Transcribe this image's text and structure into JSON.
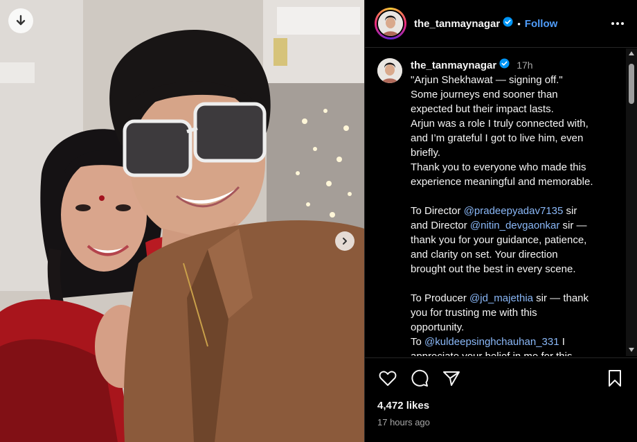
{
  "post": {
    "username": "the_tanmaynagar",
    "follow_label": "Follow",
    "separator": "•",
    "time_short": "17h",
    "likes": "4,472 likes",
    "posted_ago": "17 hours ago"
  },
  "caption": {
    "lines": [
      "\"Arjun Shekhawat — signing off.\"",
      "Some journeys end sooner than",
      "expected but their impact lasts.",
      "Arjun was a role I truly connected with,",
      "and I’m grateful I got to live him, even",
      "briefly.",
      "Thank you to everyone who made this",
      "experience meaningful and memorable."
    ],
    "director_line1_prefix": "To Director ",
    "director_mention1": "@pradeepyadav7135",
    "director_line1_suffix": " sir",
    "director_line2_prefix": "and Director ",
    "director_mention2": "@nitin_devgaonkar",
    "director_line2_suffix": " sir —",
    "director_lines": [
      "thank you for your guidance, patience,",
      "and clarity on set. Your direction",
      "brought out the best in every scene."
    ],
    "producer_prefix": "To Producer ",
    "producer_mention": "@jd_majethia",
    "producer_suffix": " sir — thank",
    "producer_lines": [
      "you for trusting me with this",
      "opportunity."
    ],
    "last_prefix": "To ",
    "last_mention": "@kuldeepsinghchauhan_331",
    "last_suffix": " I",
    "cut_line": "appreciate your belief in me for this"
  },
  "icons": {
    "download": "download-icon",
    "next": "chevron-right-icon",
    "more": "more-options-icon",
    "like": "heart-icon",
    "comment": "comment-icon",
    "share": "share-icon",
    "save": "bookmark-icon",
    "verified": "verified-badge-icon"
  },
  "colors": {
    "background": "#000000",
    "link": "#4f9cf9",
    "mention": "#8ab8f8",
    "muted": "#a8a8a8",
    "verified": "#0095f6"
  }
}
